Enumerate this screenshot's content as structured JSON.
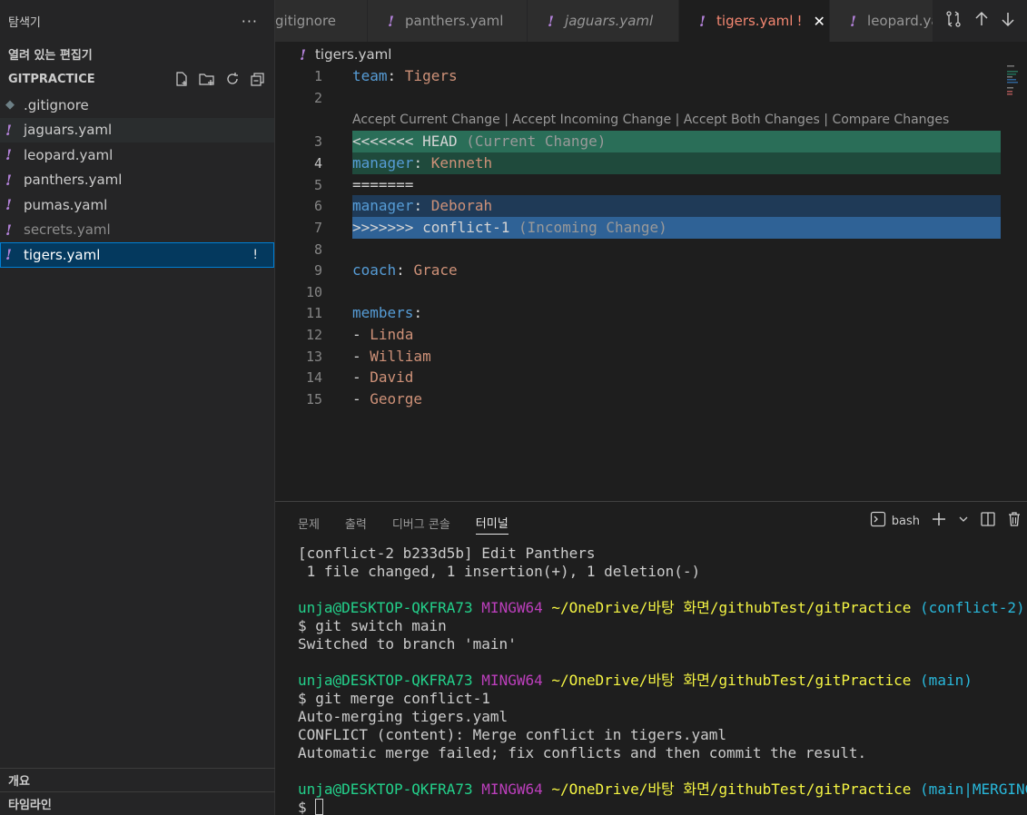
{
  "sidebar": {
    "title": "탐색기",
    "open_editors": "열려 있는 편집기",
    "folder": "GITPRACTICE",
    "files": [
      {
        "name": ".gitignore",
        "icon": "git-icon",
        "style": "normal",
        "badge": ""
      },
      {
        "name": "jaguars.yaml",
        "icon": "yaml-icon",
        "style": "hover",
        "badge": ""
      },
      {
        "name": "leopard.yaml",
        "icon": "yaml-icon",
        "style": "normal",
        "badge": ""
      },
      {
        "name": "panthers.yaml",
        "icon": "yaml-icon",
        "style": "normal",
        "badge": ""
      },
      {
        "name": "pumas.yaml",
        "icon": "yaml-icon",
        "style": "normal",
        "badge": ""
      },
      {
        "name": "secrets.yaml",
        "icon": "yaml-icon",
        "style": "dim",
        "badge": ""
      },
      {
        "name": "tigers.yaml",
        "icon": "yaml-icon",
        "style": "selected",
        "badge": "!"
      }
    ],
    "outline": "개요",
    "timeline": "타임라인"
  },
  "tabs": [
    {
      "label": "gitignore",
      "icon": "",
      "italic": false,
      "active": false
    },
    {
      "label": "panthers.yaml",
      "icon": "!",
      "italic": false,
      "active": false
    },
    {
      "label": "jaguars.yaml",
      "icon": "!",
      "italic": true,
      "active": false
    },
    {
      "label": "tigers.yaml",
      "icon": "!",
      "italic": false,
      "active": true,
      "modified": "!"
    },
    {
      "label": "leopard.yaml",
      "icon": "!",
      "italic": false,
      "active": false
    }
  ],
  "breadcrumb": {
    "icon": "!",
    "file": "tigers.yaml"
  },
  "editor": {
    "codelens": "Accept Current Change | Accept Incoming Change | Accept Both Changes | Compare Changes",
    "lines": [
      {
        "n": "1",
        "key": "team",
        "sep": ": ",
        "val": "Tigers"
      },
      {
        "n": "2"
      },
      {
        "n": "3",
        "marker": "<<<<<<< HEAD",
        "note": " (Current Change)"
      },
      {
        "n": "4",
        "key": "manager",
        "sep": ": ",
        "val": "Kenneth"
      },
      {
        "n": "5",
        "marker": "======="
      },
      {
        "n": "6",
        "key": "manager",
        "sep": ": ",
        "val": "Deborah"
      },
      {
        "n": "7",
        "marker": ">>>>>>> conflict-1",
        "note": " (Incoming Change)"
      },
      {
        "n": "8"
      },
      {
        "n": "9",
        "key": "coach",
        "sep": ": ",
        "val": "Grace"
      },
      {
        "n": "10"
      },
      {
        "n": "11",
        "key": "members",
        "sep": ":"
      },
      {
        "n": "12",
        "dash": "- ",
        "val": "Linda"
      },
      {
        "n": "13",
        "dash": "- ",
        "val": "William"
      },
      {
        "n": "14",
        "dash": "- ",
        "val": "David"
      },
      {
        "n": "15",
        "dash": "- ",
        "val": "George"
      }
    ]
  },
  "panel": {
    "tabs": [
      "문제",
      "출력",
      "디버그 콘솔",
      "터미널"
    ],
    "active_tab": "터미널",
    "shell": "bash",
    "terminal": {
      "l1": "[conflict-2 b233d5b] Edit Panthers",
      "l2": " 1 file changed, 1 insertion(+), 1 deletion(-)",
      "user": "unja@DESKTOP-QKFRA73",
      "host": "MINGW64",
      "path": "~/OneDrive/바탕 화면/githubTest/gitPractice",
      "branch1": "(conflict-2)",
      "cmd1": "$ git switch main",
      "out1": "Switched to branch 'main'",
      "branch2": "(main)",
      "cmd2": "$ git merge conflict-1",
      "out2a": "Auto-merging tigers.yaml",
      "out2b": "CONFLICT (content): Merge conflict in tigers.yaml",
      "out2c": "Automatic merge failed; fix conflicts and then commit the result.",
      "branch3": "(main|MERGING)",
      "prompt": "$ "
    }
  }
}
